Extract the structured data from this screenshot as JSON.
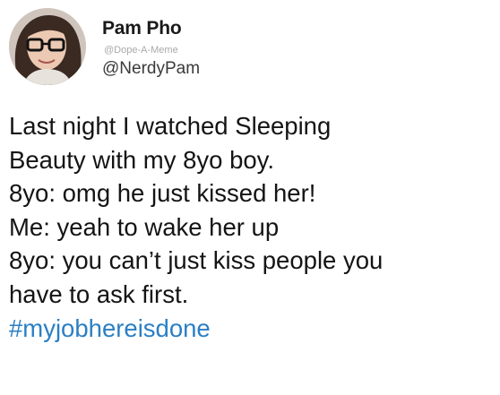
{
  "author": {
    "display_name": "Pam Pho",
    "watermark": "@Dope-A-Meme",
    "handle": "@NerdyPam",
    "avatar_icon": "profile-photo-woman-glasses"
  },
  "tweet": {
    "lines": [
      "Last night I watched Sleeping",
      "Beauty with my 8yo boy.",
      "8yo: omg he just kissed her!",
      "Me: yeah to wake her up",
      "8yo: you can’t just kiss people you",
      "have to ask first."
    ],
    "hashtag": "#myjobhereisdone"
  },
  "colors": {
    "hashtag": "#2b7fc4",
    "text": "#141414",
    "background": "#ffffff"
  }
}
